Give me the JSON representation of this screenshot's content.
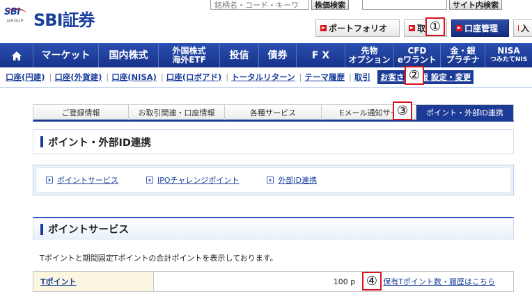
{
  "header": {
    "logo_mark": "SBI",
    "logo_group": "GROUP",
    "brand_name": "SBI証券",
    "search_placeholder": "銘柄名・コード・キーワ",
    "stock_search_label": "株価検索",
    "site_search_label": "サイト内検索",
    "buttons": {
      "portfolio": "ポートフォリオ",
      "trade": "取引",
      "account": "口座管理",
      "cut": "入"
    }
  },
  "nav": {
    "home_icon": "home-icon",
    "items": [
      {
        "line1": "マーケット",
        "line2": ""
      },
      {
        "line1": "国内株式",
        "line2": ""
      },
      {
        "line1": "外国株式",
        "line2": "海外ETF"
      },
      {
        "line1": "投信",
        "line2": ""
      },
      {
        "line1": "債券",
        "line2": ""
      },
      {
        "line1": "F X",
        "line2": ""
      },
      {
        "line1": "先物",
        "line2": "オプション"
      },
      {
        "line1": "CFD",
        "line2": "eワラント"
      },
      {
        "line1": "金・銀",
        "line2": "プラチナ"
      },
      {
        "line1": "NISA",
        "line2": "つみたてNIS"
      }
    ]
  },
  "subnav": {
    "items": [
      "口座(円建)",
      "口座(外貨建)",
      "口座(NISA)",
      "口座(ロボアド)",
      "トータルリターン",
      "テーマ履歴",
      "取引"
    ],
    "active": "お客さま情報 設定・変更"
  },
  "tabs": [
    "ご登録情報",
    "お取引関連・口座情報",
    "各種サービス",
    "Eメール通知サー",
    "ポイント・外部ID連携"
  ],
  "page_title": "ポイント・外部ID連携",
  "anchors": [
    "ポイントサービス",
    "IPOチャレンジポイント",
    "外部ID連携"
  ],
  "section": {
    "title": "ポイントサービス",
    "description": "Tポイントと期間固定Tポイントの合計ポイントを表示しております。"
  },
  "point_table": {
    "label": "Tポイント",
    "value": "100 p",
    "history_link": "保有Tポイント数・履歴はこちら"
  },
  "markers": [
    "①",
    "②",
    "③",
    "④"
  ],
  "colors": {
    "brand_blue": "#1c3b96",
    "accent_red": "#d8141c"
  }
}
